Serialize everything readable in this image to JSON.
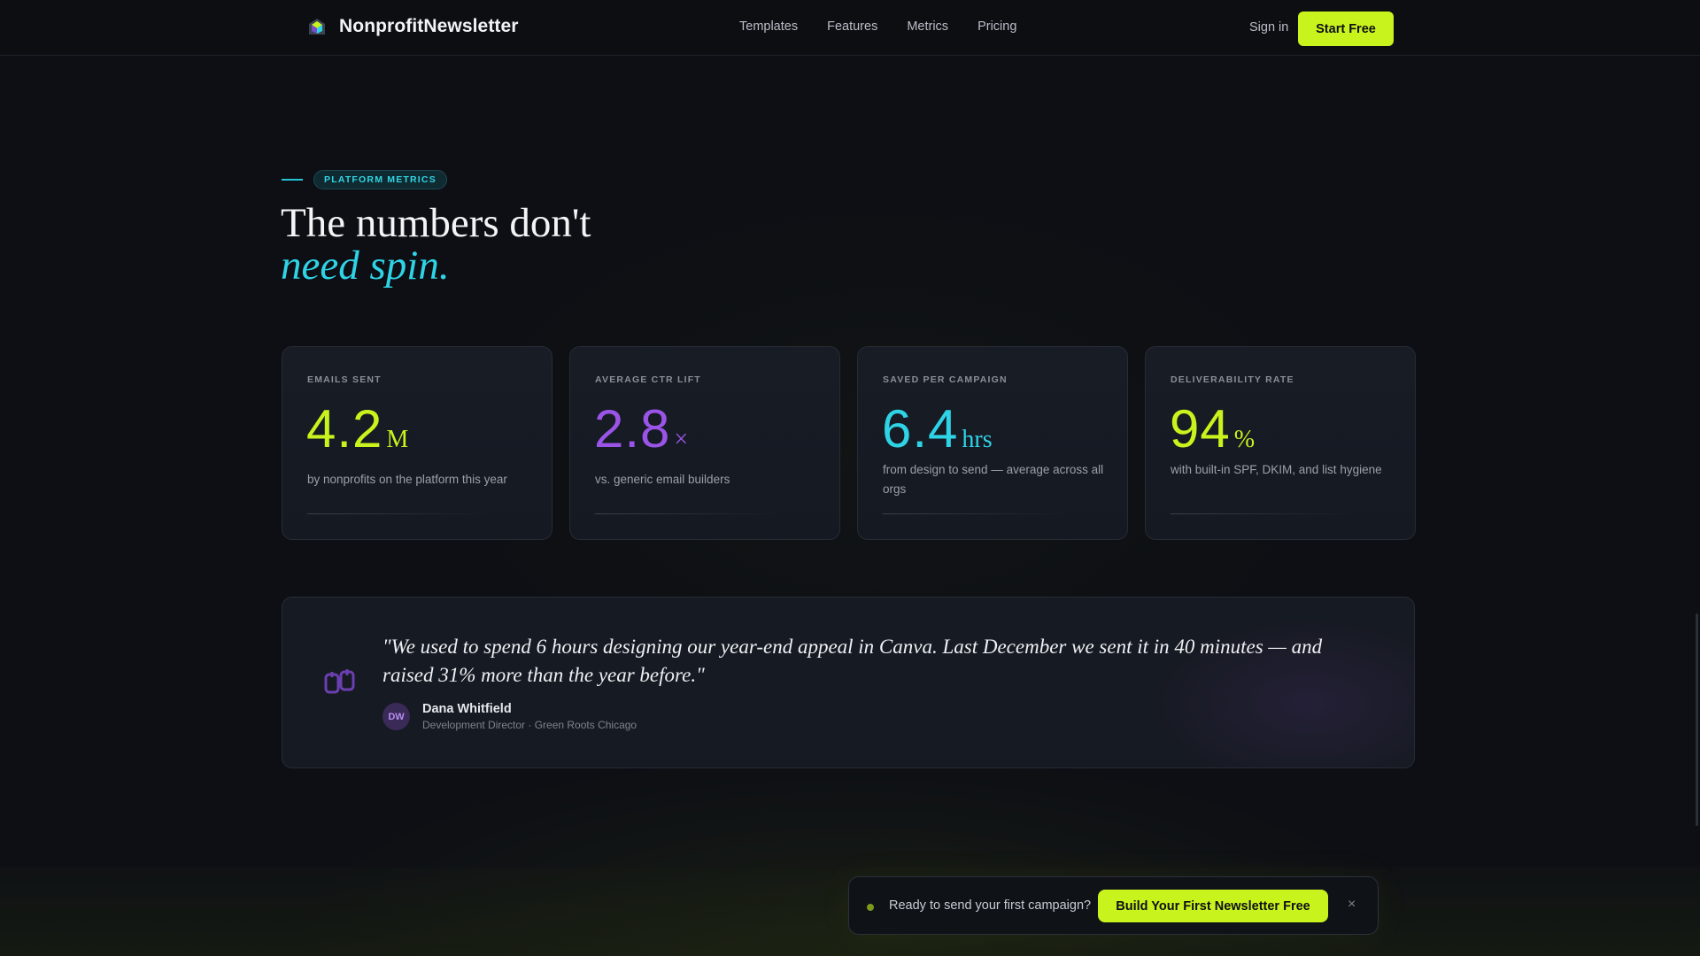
{
  "header": {
    "brand": "NonprofitNewsletter",
    "nav": [
      "Templates",
      "Features",
      "Metrics",
      "Pricing"
    ],
    "signin": "Sign in",
    "start_label": "Start Free"
  },
  "section": {
    "eyebrow": "PLATFORM METRICS",
    "headline_line1": "The numbers don't",
    "headline_line2": "need spin."
  },
  "metrics": [
    {
      "label": "EMAILS SENT",
      "value": "4.2",
      "unit": "M",
      "desc": "by nonprofits on the platform this year",
      "accent": "#c9f31d"
    },
    {
      "label": "AVERAGE CTR LIFT",
      "value": "2.8",
      "unit": "×",
      "desc": "vs. generic email builders",
      "accent": "#9a55e8"
    },
    {
      "label": "SAVED PER CAMPAIGN",
      "value": "6.4",
      "unit": "hrs",
      "desc": "from design to send — average across all orgs",
      "accent": "#2fd3e6"
    },
    {
      "label": "DELIVERABILITY RATE",
      "value": "94",
      "unit": "%",
      "desc": "with built-in SPF, DKIM, and list hygiene",
      "accent": "#c9f31d"
    }
  ],
  "testimonial": {
    "quote": "\"We used to spend 6 hours designing our year-end appeal in Canva. Last December we sent it in 40 minutes — and raised 31% more than the year before.\"",
    "initials": "DW",
    "name": "Dana Whitfield",
    "role": "Development Director · Green Roots Chicago"
  },
  "cta": {
    "text": "Ready to send your first campaign?",
    "button": "Build Your First Newsletter Free",
    "close": "×"
  }
}
